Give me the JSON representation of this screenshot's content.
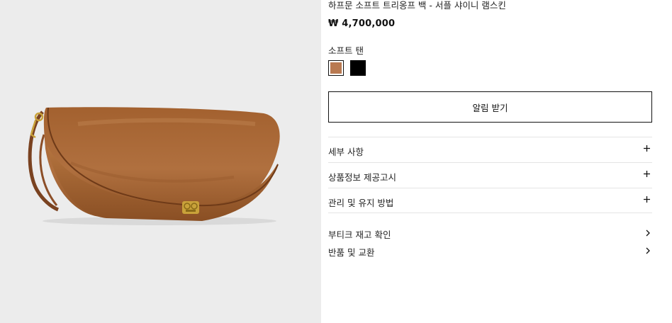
{
  "product": {
    "title": "하프문 소프트 트리옹프 백 - 서플 샤이니 램스킨",
    "price": "₩ 4,700,000",
    "color_name": "소프트 탠",
    "swatches": [
      {
        "name": "soft-tan",
        "color": "#b97a51",
        "selected": true
      },
      {
        "name": "black",
        "color": "#000000",
        "selected": false
      }
    ]
  },
  "actions": {
    "notify_label": "알림 받기"
  },
  "accordion": [
    {
      "label": "세부 사항",
      "icon": "plus-icon"
    },
    {
      "label": "상품정보 제공고시",
      "icon": "plus-icon"
    },
    {
      "label": "관리 및 유지 방법",
      "icon": "plus-icon"
    }
  ],
  "links": [
    {
      "label": "부티크 재고 확인",
      "icon": "chevron-right-icon"
    },
    {
      "label": "반품 및 교환",
      "icon": "chevron-right-icon"
    }
  ],
  "image": {
    "alt_icon": "handbag-image",
    "background": "#ececec",
    "leather": "#a9673a",
    "hardware": "#c9a23a"
  }
}
